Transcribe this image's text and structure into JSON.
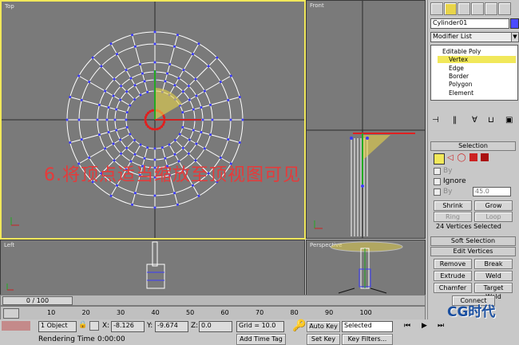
{
  "viewports": {
    "top_label": "Top",
    "front_label": "Front",
    "left_label": "Left",
    "perspective_label": "Perspective"
  },
  "caption": "6.将顶点适当缩放至顶视图可见",
  "command_panel": {
    "object_name": "Cylinder01",
    "modifier_list_label": "Modifier List",
    "stack": [
      "Editable Poly",
      "Vertex",
      "Edge",
      "Border",
      "Polygon",
      "Element"
    ],
    "selection_rollout": "Selection",
    "by_label": "By",
    "ignore_label": "Ignore",
    "by_angle_label": "By",
    "angle_value": "45.0",
    "shrink": "Shrink",
    "grow": "Grow",
    "ring": "Ring",
    "loop": "Loop",
    "selection_status": "24 Vertices Selected",
    "soft_selection_rollout": "Soft Selection",
    "edit_vertices_rollout": "Edit Vertices",
    "remove": "Remove",
    "break": "Break",
    "extrude": "Extrude",
    "weld": "Weld",
    "chamfer": "Chamfer",
    "target_weld": "Target Weld",
    "connect": "Connect"
  },
  "timeline": {
    "frame_display": "0 / 100",
    "ticks": [
      "10",
      "20",
      "30",
      "40",
      "50",
      "60",
      "70",
      "80",
      "90",
      "100"
    ]
  },
  "status": {
    "objects": "1 Object",
    "x_label": "X:",
    "x_value": "-8.126",
    "y_label": "Y:",
    "y_value": "-9.674",
    "z_label": "Z:",
    "z_value": "0.0",
    "grid": "Grid = 10.0",
    "auto_key": "Auto Key",
    "selected": "Selected",
    "set_key": "Set Key",
    "key_filters": "Key Filters...",
    "rendering_time_label": "Rendering Time",
    "rendering_time_value": "0:00:00",
    "add_time_tag": "Add Time Tag"
  },
  "watermark": "CG时代",
  "colors": {
    "active_border": "#f1e85a",
    "viewport_bg": "#7a7a7a",
    "selection_accent": "#f1e85a"
  }
}
